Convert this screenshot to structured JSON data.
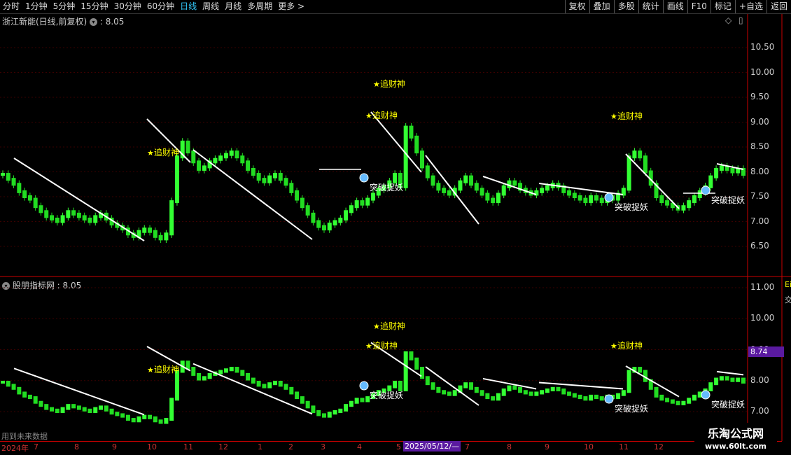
{
  "toolbar": {
    "periods": [
      "分时",
      "1分钟",
      "5分钟",
      "15分钟",
      "30分钟",
      "60分钟",
      "日线",
      "周线",
      "月线",
      "多周期",
      "更多 >"
    ],
    "active": "日线",
    "buttons": [
      "复权",
      "叠加",
      "多股",
      "统计",
      "画线",
      "F10",
      "标记",
      "+自选",
      "返回"
    ]
  },
  "main_chart": {
    "title": "浙江新能(日线,前复权)",
    "value": ": 8.05",
    "yticks": [
      "10.50",
      "10.00",
      "9.50",
      "9.00",
      "8.50",
      "8.00",
      "7.50",
      "7.00",
      "6.50"
    ]
  },
  "sub_chart": {
    "title": "股朋指标网",
    "value": ": 8.05",
    "yticks": [
      "11.00",
      "10.00",
      "9.00",
      "8.00",
      "7.00"
    ],
    "price_tag": "8.74",
    "right_clip_top": "Ei",
    "right_clip_mid": "交"
  },
  "signals": {
    "buy_label": "追财神",
    "break_label": "突破捉妖"
  },
  "future_note": "用到未来数据",
  "date_axis": {
    "labels": [
      "2024年",
      "7",
      "8",
      "9",
      "10",
      "11",
      "12",
      "1",
      "2",
      "3",
      "4",
      "5",
      "7",
      "8",
      "9",
      "10",
      "11",
      "12"
    ],
    "cursor": "2025/05/12/—"
  },
  "watermark": {
    "name": "乐淘公式网",
    "url": "www.60lt.com"
  },
  "chart_data": {
    "type": "line",
    "title": "浙江新能(日线,前复权)",
    "ylim": [
      6.2,
      10.8
    ],
    "series": [
      {
        "name": "浙江新能",
        "values": [
          7.95,
          7.85,
          7.75,
          7.6,
          7.5,
          7.45,
          7.3,
          7.2,
          7.1,
          7.05,
          7.0,
          7.1,
          7.2,
          7.15,
          7.1,
          7.05,
          7.0,
          7.1,
          7.15,
          7.05,
          6.95,
          6.9,
          6.85,
          6.75,
          6.7,
          6.8,
          6.85,
          6.8,
          6.7,
          6.65,
          6.75,
          7.4,
          8.3,
          8.6,
          8.4,
          8.2,
          8.05,
          8.1,
          8.2,
          8.25,
          8.3,
          8.35,
          8.4,
          8.3,
          8.2,
          8.05,
          7.95,
          7.85,
          7.8,
          7.9,
          7.95,
          7.85,
          7.75,
          7.6,
          7.45,
          7.3,
          7.15,
          7.0,
          6.9,
          6.85,
          6.95,
          7.0,
          7.05,
          7.2,
          7.3,
          7.4,
          7.35,
          7.45,
          7.55,
          7.65,
          7.7,
          7.8,
          7.95,
          7.7,
          8.9,
          8.7,
          8.4,
          8.1,
          7.9,
          7.75,
          7.65,
          7.6,
          7.55,
          7.65,
          7.8,
          7.9,
          7.75,
          7.65,
          7.55,
          7.45,
          7.4,
          7.55,
          7.7,
          7.8,
          7.75,
          7.65,
          7.6,
          7.55,
          7.6,
          7.65,
          7.7,
          7.75,
          7.7,
          7.6,
          7.55,
          7.5,
          7.45,
          7.4,
          7.5,
          7.45,
          7.4,
          7.5,
          7.45,
          7.55,
          7.65,
          8.3,
          8.4,
          8.3,
          8.0,
          7.75,
          7.5,
          7.4,
          7.35,
          7.3,
          7.25,
          7.3,
          7.4,
          7.5,
          7.6,
          7.7,
          7.9,
          8.05,
          8.1,
          8.05,
          8.0,
          8.05,
          7.95
        ]
      }
    ]
  }
}
